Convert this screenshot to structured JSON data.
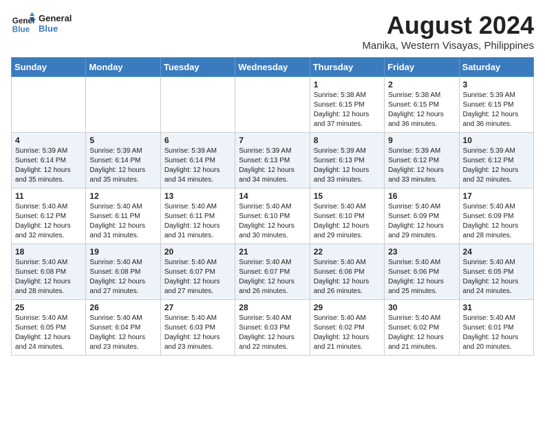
{
  "header": {
    "logo_general": "General",
    "logo_blue": "Blue",
    "month_year": "August 2024",
    "location": "Manika, Western Visayas, Philippines"
  },
  "weekdays": [
    "Sunday",
    "Monday",
    "Tuesday",
    "Wednesday",
    "Thursday",
    "Friday",
    "Saturday"
  ],
  "weeks": [
    [
      {
        "day": "",
        "info": ""
      },
      {
        "day": "",
        "info": ""
      },
      {
        "day": "",
        "info": ""
      },
      {
        "day": "",
        "info": ""
      },
      {
        "day": "1",
        "info": "Sunrise: 5:38 AM\nSunset: 6:15 PM\nDaylight: 12 hours\nand 37 minutes."
      },
      {
        "day": "2",
        "info": "Sunrise: 5:38 AM\nSunset: 6:15 PM\nDaylight: 12 hours\nand 36 minutes."
      },
      {
        "day": "3",
        "info": "Sunrise: 5:39 AM\nSunset: 6:15 PM\nDaylight: 12 hours\nand 36 minutes."
      }
    ],
    [
      {
        "day": "4",
        "info": "Sunrise: 5:39 AM\nSunset: 6:14 PM\nDaylight: 12 hours\nand 35 minutes."
      },
      {
        "day": "5",
        "info": "Sunrise: 5:39 AM\nSunset: 6:14 PM\nDaylight: 12 hours\nand 35 minutes."
      },
      {
        "day": "6",
        "info": "Sunrise: 5:39 AM\nSunset: 6:14 PM\nDaylight: 12 hours\nand 34 minutes."
      },
      {
        "day": "7",
        "info": "Sunrise: 5:39 AM\nSunset: 6:13 PM\nDaylight: 12 hours\nand 34 minutes."
      },
      {
        "day": "8",
        "info": "Sunrise: 5:39 AM\nSunset: 6:13 PM\nDaylight: 12 hours\nand 33 minutes."
      },
      {
        "day": "9",
        "info": "Sunrise: 5:39 AM\nSunset: 6:12 PM\nDaylight: 12 hours\nand 33 minutes."
      },
      {
        "day": "10",
        "info": "Sunrise: 5:39 AM\nSunset: 6:12 PM\nDaylight: 12 hours\nand 32 minutes."
      }
    ],
    [
      {
        "day": "11",
        "info": "Sunrise: 5:40 AM\nSunset: 6:12 PM\nDaylight: 12 hours\nand 32 minutes."
      },
      {
        "day": "12",
        "info": "Sunrise: 5:40 AM\nSunset: 6:11 PM\nDaylight: 12 hours\nand 31 minutes."
      },
      {
        "day": "13",
        "info": "Sunrise: 5:40 AM\nSunset: 6:11 PM\nDaylight: 12 hours\nand 31 minutes."
      },
      {
        "day": "14",
        "info": "Sunrise: 5:40 AM\nSunset: 6:10 PM\nDaylight: 12 hours\nand 30 minutes."
      },
      {
        "day": "15",
        "info": "Sunrise: 5:40 AM\nSunset: 6:10 PM\nDaylight: 12 hours\nand 29 minutes."
      },
      {
        "day": "16",
        "info": "Sunrise: 5:40 AM\nSunset: 6:09 PM\nDaylight: 12 hours\nand 29 minutes."
      },
      {
        "day": "17",
        "info": "Sunrise: 5:40 AM\nSunset: 6:09 PM\nDaylight: 12 hours\nand 28 minutes."
      }
    ],
    [
      {
        "day": "18",
        "info": "Sunrise: 5:40 AM\nSunset: 6:08 PM\nDaylight: 12 hours\nand 28 minutes."
      },
      {
        "day": "19",
        "info": "Sunrise: 5:40 AM\nSunset: 6:08 PM\nDaylight: 12 hours\nand 27 minutes."
      },
      {
        "day": "20",
        "info": "Sunrise: 5:40 AM\nSunset: 6:07 PM\nDaylight: 12 hours\nand 27 minutes."
      },
      {
        "day": "21",
        "info": "Sunrise: 5:40 AM\nSunset: 6:07 PM\nDaylight: 12 hours\nand 26 minutes."
      },
      {
        "day": "22",
        "info": "Sunrise: 5:40 AM\nSunset: 6:06 PM\nDaylight: 12 hours\nand 26 minutes."
      },
      {
        "day": "23",
        "info": "Sunrise: 5:40 AM\nSunset: 6:06 PM\nDaylight: 12 hours\nand 25 minutes."
      },
      {
        "day": "24",
        "info": "Sunrise: 5:40 AM\nSunset: 6:05 PM\nDaylight: 12 hours\nand 24 minutes."
      }
    ],
    [
      {
        "day": "25",
        "info": "Sunrise: 5:40 AM\nSunset: 6:05 PM\nDaylight: 12 hours\nand 24 minutes."
      },
      {
        "day": "26",
        "info": "Sunrise: 5:40 AM\nSunset: 6:04 PM\nDaylight: 12 hours\nand 23 minutes."
      },
      {
        "day": "27",
        "info": "Sunrise: 5:40 AM\nSunset: 6:03 PM\nDaylight: 12 hours\nand 23 minutes."
      },
      {
        "day": "28",
        "info": "Sunrise: 5:40 AM\nSunset: 6:03 PM\nDaylight: 12 hours\nand 22 minutes."
      },
      {
        "day": "29",
        "info": "Sunrise: 5:40 AM\nSunset: 6:02 PM\nDaylight: 12 hours\nand 21 minutes."
      },
      {
        "day": "30",
        "info": "Sunrise: 5:40 AM\nSunset: 6:02 PM\nDaylight: 12 hours\nand 21 minutes."
      },
      {
        "day": "31",
        "info": "Sunrise: 5:40 AM\nSunset: 6:01 PM\nDaylight: 12 hours\nand 20 minutes."
      }
    ]
  ]
}
